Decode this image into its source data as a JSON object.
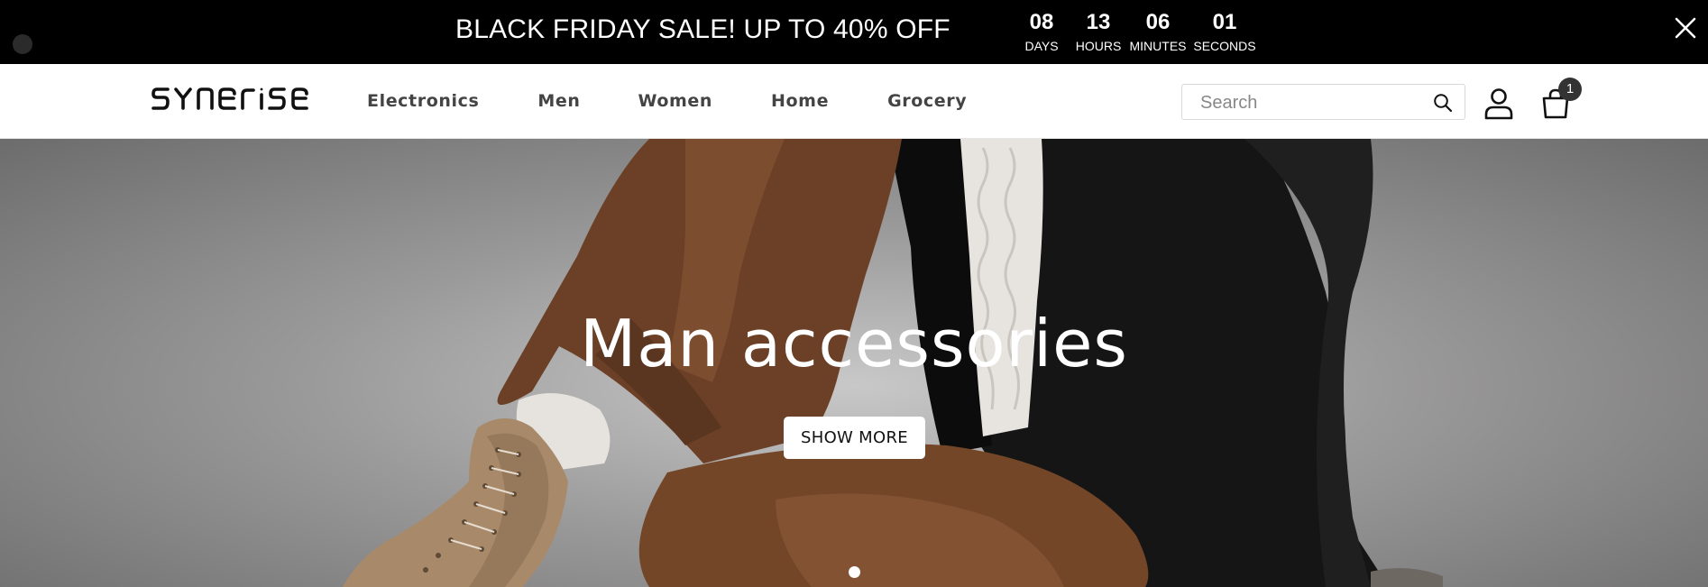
{
  "promo": {
    "text": "BLACK FRIDAY SALE! UP TO 40% OFF",
    "countdown": [
      {
        "value": "08",
        "label": "DAYS"
      },
      {
        "value": "13",
        "label": "HOURS"
      },
      {
        "value": "06",
        "label": "MINUTES"
      },
      {
        "value": "01",
        "label": "SECONDS"
      }
    ],
    "close_icon": "close-icon"
  },
  "header": {
    "logo_text": "SYNERISE",
    "nav": [
      "Electronics",
      "Men",
      "Women",
      "Home",
      "Grocery"
    ],
    "search": {
      "placeholder": "Search",
      "value": ""
    },
    "icons": [
      "search-icon",
      "account-icon",
      "cart-icon"
    ],
    "cart_count": "1"
  },
  "hero": {
    "title": "Man accessories",
    "button_label": "SHOW MORE",
    "slide_count": 1,
    "active_slide": 1
  },
  "colors": {
    "promo_bg": "#000000",
    "header_bg": "#ffffff",
    "nav_text": "#444444",
    "hero_overlay_text": "#ffffff"
  }
}
